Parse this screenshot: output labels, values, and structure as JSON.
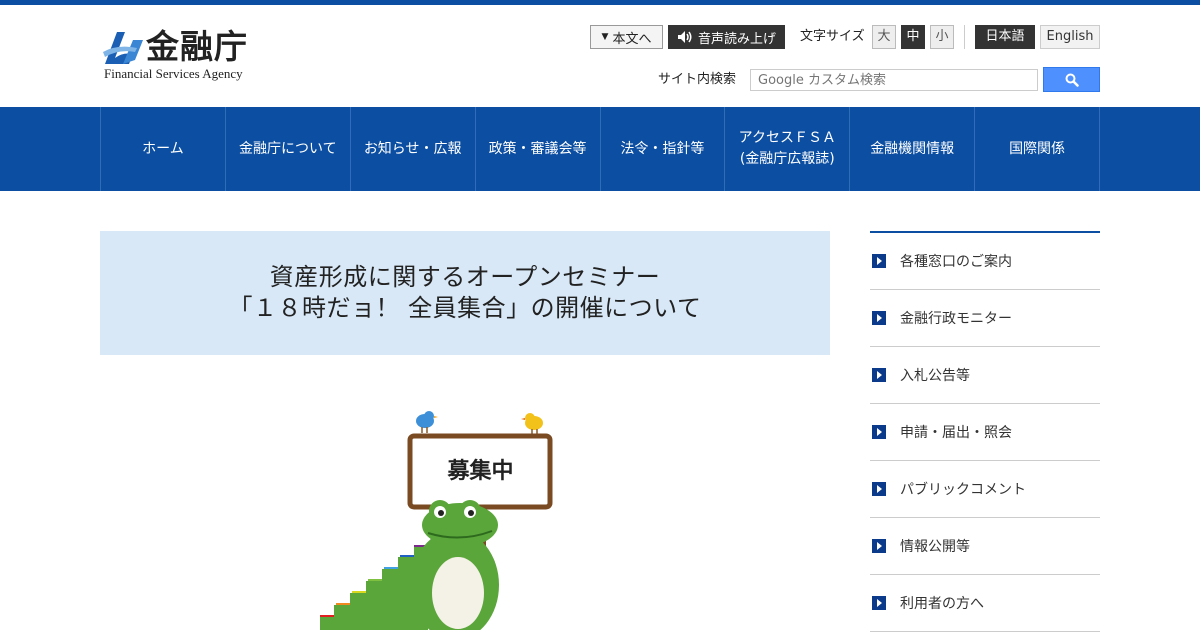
{
  "site": {
    "logo_jp": "金融庁",
    "logo_en": "Financial Services Agency"
  },
  "utility": {
    "skip_label": "本文へ",
    "read_label": "音声読み上げ",
    "font_size_label": "文字サイズ",
    "font_sizes": [
      "大",
      "中",
      "小"
    ],
    "font_size_selected": "中",
    "lang_jp": "日本語",
    "lang_en": "English"
  },
  "search": {
    "label": "サイト内検索",
    "placeholder": "Google カスタム検索"
  },
  "nav": {
    "items": [
      {
        "label": "ホーム"
      },
      {
        "label": "金融庁について"
      },
      {
        "label": "お知らせ・広報"
      },
      {
        "label": "政策・審議会等"
      },
      {
        "label": "法令・指針等"
      },
      {
        "label": "アクセスＦＳＡ\n(金融庁広報誌)"
      },
      {
        "label": "金融機関情報"
      },
      {
        "label": "国際関係"
      }
    ]
  },
  "banner": {
    "line1": "資産形成に関するオープンセミナー",
    "line2": "「１８時だョ！ 全員集合」の開催について"
  },
  "illustration": {
    "sign_text": "募集中"
  },
  "sidebar": {
    "items": [
      {
        "label": "各種窓口のご案内"
      },
      {
        "label": "金融行政モニター"
      },
      {
        "label": "入札公告等"
      },
      {
        "label": "申請・届出・照会"
      },
      {
        "label": "パブリックコメント"
      },
      {
        "label": "情報公開等"
      },
      {
        "label": "利用者の方へ"
      }
    ]
  },
  "colors": {
    "brand_blue": "#0b4ea2",
    "banner_bg": "#d8e8f7",
    "search_blue": "#4d90fe",
    "mascot_green": "#5aa63a"
  }
}
